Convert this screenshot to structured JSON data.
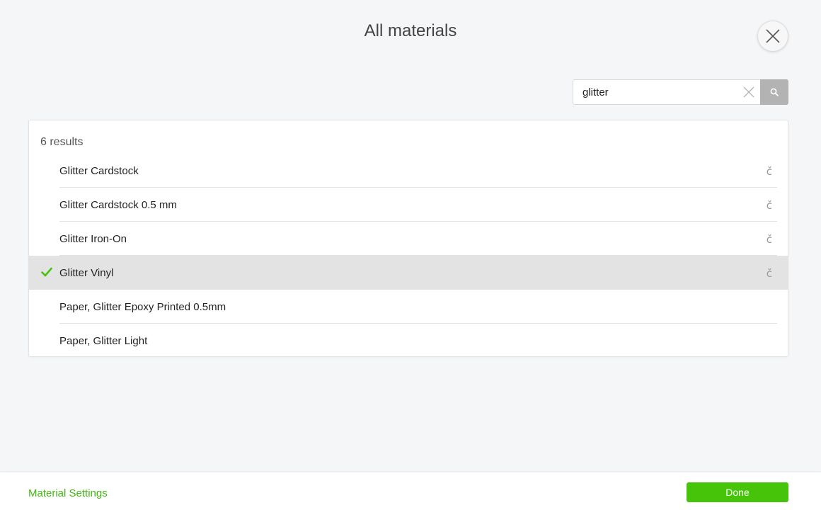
{
  "header": {
    "title": "All materials"
  },
  "search": {
    "value": "glitter",
    "placeholder": "Search"
  },
  "results": {
    "count_label": "6 results",
    "items": [
      {
        "label": "Glitter Cardstock",
        "selected": false,
        "cricut": true
      },
      {
        "label": "Glitter Cardstock 0.5 mm",
        "selected": false,
        "cricut": true
      },
      {
        "label": "Glitter Iron-On",
        "selected": false,
        "cricut": true
      },
      {
        "label": "Glitter Vinyl",
        "selected": true,
        "cricut": true
      },
      {
        "label": "Paper, Glitter Epoxy Printed 0.5mm",
        "selected": false,
        "cricut": false
      },
      {
        "label": "Paper, Glitter Light",
        "selected": false,
        "cricut": false
      }
    ]
  },
  "footer": {
    "settings_link": "Material Settings",
    "done_label": "Done"
  },
  "icons": {
    "close": "close-icon",
    "clear": "clear-search-icon",
    "search": "search-icon",
    "check": "checkmark-icon",
    "cricut": "cricut-c-icon",
    "cricut_glyph": "č"
  },
  "colors": {
    "accent_green": "#46c40a",
    "link_green": "#3fb90f",
    "selected_row": "#e3e3e3",
    "search_button": "#b3b3b3"
  }
}
